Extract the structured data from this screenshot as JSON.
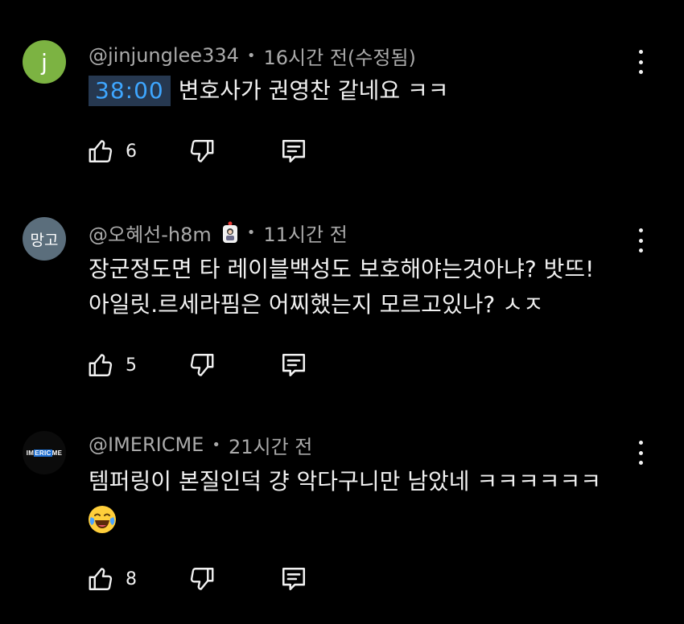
{
  "comments": [
    {
      "avatar_text": "j",
      "author": "@jinjunglee334",
      "separator": "•",
      "time": "16시간 전(수정됨)",
      "timestamp_link": "38:00",
      "text": "변호사가 권영찬 같네요 ㅋㅋ",
      "likes": "6"
    },
    {
      "avatar_text": "망고",
      "author": "@오혜선-h8m",
      "separator": "•",
      "time": "11시간 전",
      "badge_icon": "member-badge-icon",
      "text_line1": "장군정도면 타 레이블백성도 보호해야는것아냐? 밧뜨!",
      "text_line2": "아일릿.르세라핌은 어찌했는지 모르고있나? ㅅㅈ",
      "likes": "5"
    },
    {
      "avatar_text": [
        "IM",
        "ERIC",
        "ME"
      ],
      "author": "@IMERICME",
      "separator": "•",
      "time": "21시간 전",
      "text": "템퍼링이 본질인덕 걍 악다구니만 남았네 ㅋㅋㅋㅋㅋㅋ",
      "emoji": "face-with-tears-of-joy-emoji",
      "likes": "8"
    }
  ],
  "icons": {
    "like": "thumbs-up-icon",
    "dislike": "thumbs-down-icon",
    "reply": "reply-icon",
    "more": "more-vertical-icon"
  },
  "colors": {
    "background": "#000000",
    "text": "#f1f1f1",
    "meta": "#aaaaaa",
    "timestamp_link": "#3ea6ff",
    "timestamp_bg": "#263850",
    "avatar_j": "#7cb342",
    "avatar_mango": "#5b6e7c"
  }
}
